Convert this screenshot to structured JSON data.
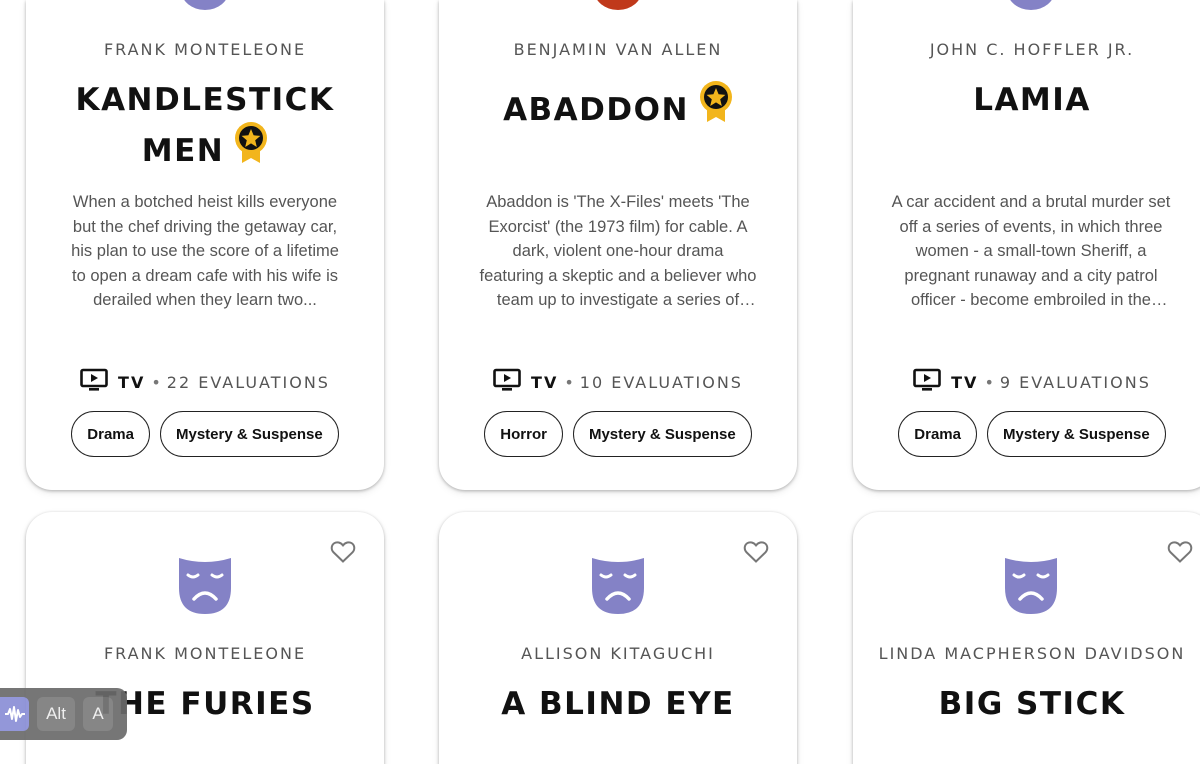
{
  "colors": {
    "accent_purple": "#8482c6",
    "accent_red": "#c0391b",
    "award_gold": "#f2b51c",
    "text_dark": "#111111",
    "text_muted": "#555555"
  },
  "cards_top": [
    {
      "author": "FRANK MONTELEONE",
      "title": "KANDLESTICK MEN",
      "title_line1": "KANDLESTICK",
      "title_line2": "MEN",
      "awarded": true,
      "description": "When a botched heist kills everyone but the chef driving the getaway car, his plan to use the score of a lifetime to open a dream cafe with his wife is derailed when they learn two...",
      "format": "TV",
      "evaluations": "22 EVALUATIONS",
      "tags": [
        "Drama",
        "Mystery & Suspense"
      ],
      "icon_color": "#8482c6"
    },
    {
      "author": "BENJAMIN VAN ALLEN",
      "title": "ABADDON",
      "awarded": true,
      "description": "Abaddon is 'The X-Files' meets 'The Exorcist' (the 1973 film) for cable. A dark, violent one-hour drama featuring a skeptic and a believer who team up to investigate a series of sadistic...",
      "format": "TV",
      "evaluations": "10 EVALUATIONS",
      "tags": [
        "Horror",
        "Mystery & Suspense"
      ],
      "icon_color": "#c0391b"
    },
    {
      "author": "JOHN C. HOFFLER JR.",
      "title": "LAMIA",
      "awarded": false,
      "description": "A car accident and a brutal murder set off a series of events, in which three women - a small-town Sheriff, a pregnant runaway and a city patrol officer - become embroiled in the dar...",
      "format": "TV",
      "evaluations": "9 EVALUATIONS",
      "tags": [
        "Drama",
        "Mystery & Suspense"
      ],
      "icon_color": "#8482c6"
    }
  ],
  "cards_bottom": [
    {
      "author": "FRANK MONTELEONE",
      "title": "THE FURIES",
      "icon": "sad-mask-icon"
    },
    {
      "author": "ALLISON KITAGUCHI",
      "title": "A BLIND EYE",
      "icon": "sad-mask-icon"
    },
    {
      "author": "LINDA MACPHERSON DAVIDSON",
      "title": "BIG STICK",
      "icon": "sad-mask-icon"
    }
  ],
  "a11y_toolbar": {
    "alt_label": "Alt",
    "a_label": "A"
  }
}
